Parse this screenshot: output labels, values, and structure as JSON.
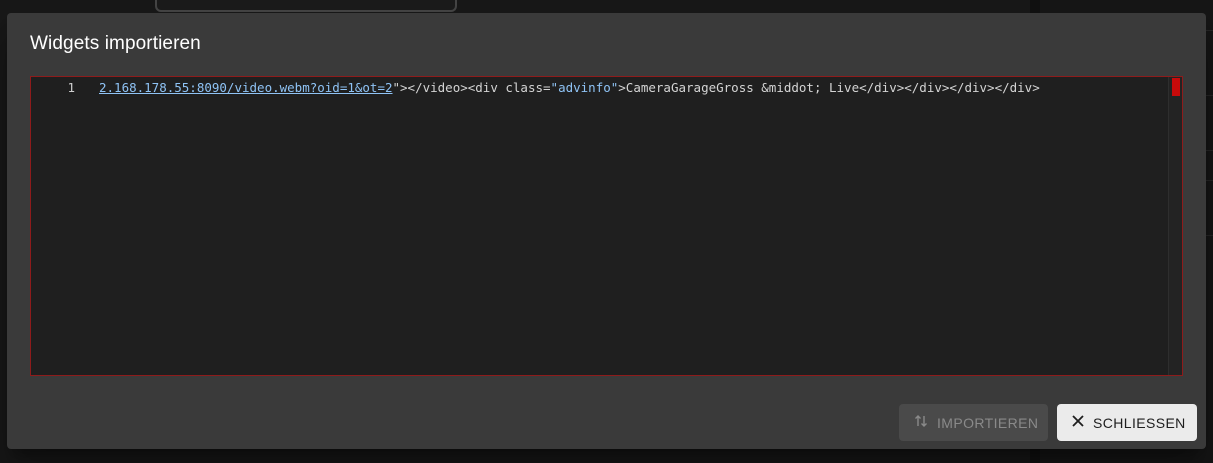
{
  "dialog": {
    "title": "Widgets importieren",
    "editor": {
      "line_number": "1",
      "code_tokens": {
        "url": "2.168.178.55:8090/video.webm?oid=1&ot=2",
        "after_url": "\"></video><div class=",
        "class_value": "\"advinfo\"",
        "tail": ">CameraGarageGross &middot; Live</div></div></div></div>"
      }
    },
    "buttons": {
      "import_label": "IMPORTIEREN",
      "import_icon": "import-export-icon",
      "close_label": "SCHLIESSEN",
      "close_icon": "close-icon"
    }
  },
  "colors": {
    "dialog_bg": "#3a3a3a",
    "editor_border": "#8e1b1b",
    "string_token": "#8fc3f5",
    "scroll_marker": "#c80a0a"
  }
}
